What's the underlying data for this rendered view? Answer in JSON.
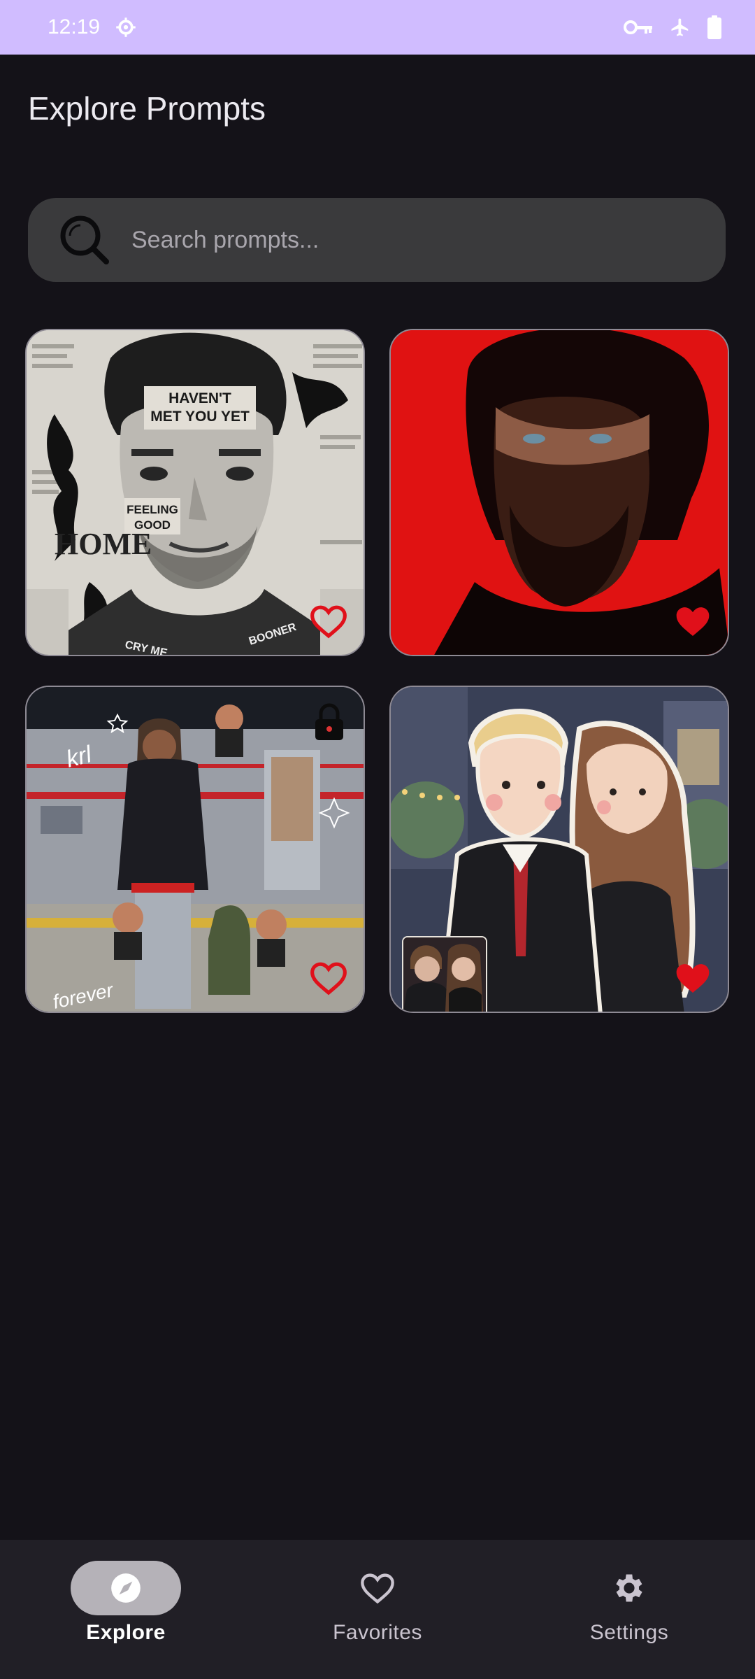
{
  "status_bar": {
    "time": "12:19"
  },
  "header": {
    "title": "Explore Prompts"
  },
  "search": {
    "placeholder": "Search prompts..."
  },
  "cards": [
    {
      "favorited": false,
      "locked": false
    },
    {
      "favorited": true,
      "locked": false
    },
    {
      "favorited": false,
      "locked": true
    },
    {
      "favorited": true,
      "locked": false
    }
  ],
  "card_texts": {
    "c1_headline_a": "HAVEN'T",
    "c1_headline_b": "MET YOU YET",
    "c1_feeling_a": "FEELING",
    "c1_feeling_b": "GOOD",
    "c1_home": "HOME",
    "c1_cry": "CRY ME",
    "c1_rooner": "BOONER",
    "c3_krl": "krl",
    "c3_forever": "forever"
  },
  "bottom_nav": {
    "items": [
      {
        "label": "Explore",
        "icon": "compass-icon",
        "active": true
      },
      {
        "label": "Favorites",
        "icon": "heart-outline-icon",
        "active": false
      },
      {
        "label": "Settings",
        "icon": "gear-icon",
        "active": false
      }
    ]
  },
  "colors": {
    "accent": "#d0bcff",
    "background": "#141218",
    "heart_red": "#e0101a"
  }
}
